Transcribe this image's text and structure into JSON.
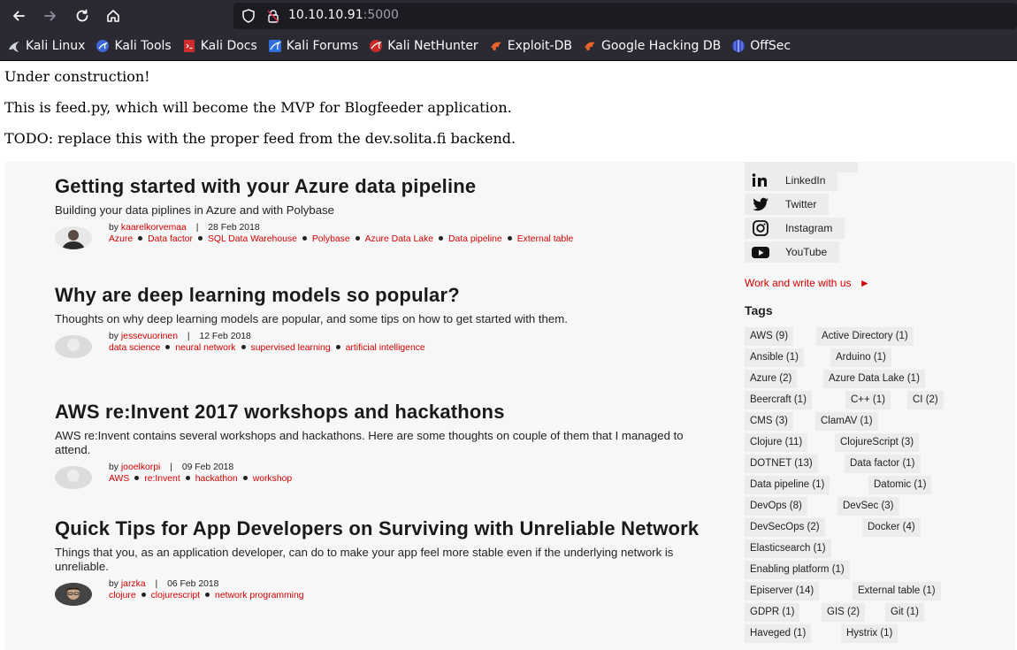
{
  "browser": {
    "url_host": "10.10.10.91",
    "url_port": ":5000",
    "bookmarks": [
      "Kali Linux",
      "Kali Tools",
      "Kali Docs",
      "Kali Forums",
      "Kali NetHunter",
      "Exploit-DB",
      "Google Hacking DB",
      "OffSec"
    ],
    "icons": {
      "back": "back-arrow-icon",
      "forward": "forward-arrow-icon",
      "reload": "reload-icon",
      "home": "home-icon",
      "shield": "shield-icon",
      "lock": "lock-icon"
    }
  },
  "page": {
    "lines": [
      "Under construction!",
      "This is feed.py, which will become the MVP for Blogfeeder application.",
      "TODO: replace this with the proper feed from the dev.solita.fi backend."
    ]
  },
  "blog": {
    "posts": [
      {
        "title": "Getting started with your Azure data pipeline",
        "desc": "Building your data piplines in Azure and with Polybase",
        "by": "by",
        "author": "kaarelkorvemaa",
        "sep": "|",
        "date": "28 Feb 2018",
        "tags": [
          "Azure",
          "Data factor",
          "SQL Data Warehouse",
          "Polybase",
          "Azure Data Lake",
          "Data pipeline",
          "External table"
        ]
      },
      {
        "title": "Why are deep learning models so popular?",
        "desc": "Thoughts on why deep learning models are popular, and some tips on how to get started with them.",
        "by": "by",
        "author": "jessevuorinen",
        "sep": "|",
        "date": "12 Feb 2018",
        "tags": [
          "data science",
          "neural network",
          "supervised learning",
          "artificial intelligence"
        ]
      },
      {
        "title": "AWS re:Invent 2017 workshops and hackathons",
        "desc": "AWS re:Invent contains several workshops and hackathons. Here are some thoughts on couple of them that I managed to attend.",
        "by": "by",
        "author": "jooelkorpi",
        "sep": "|",
        "date": "09 Feb 2018",
        "tags": [
          "AWS",
          "re:Invent",
          "hackathon",
          "workshop"
        ]
      },
      {
        "title": "Quick Tips for App Developers on Surviving with Unreliable Network",
        "desc": "Things that you, as an application developer, can do to make your app feel more stable even if the underlying network is unreliable.",
        "by": "by",
        "author": "jarzka",
        "sep": "|",
        "date": "06 Feb 2018",
        "tags": [
          "clojure",
          "clojurescript",
          "network programming"
        ]
      }
    ],
    "social": [
      {
        "label": "LinkedIn",
        "icon": "linkedin-icon"
      },
      {
        "label": "Twitter",
        "icon": "twitter-icon"
      },
      {
        "label": "Instagram",
        "icon": "instagram-icon"
      },
      {
        "label": "YouTube",
        "icon": "youtube-icon"
      }
    ],
    "write_link": "Work and write with us",
    "write_arrow": "►",
    "tags_heading": "Tags",
    "tags": [
      "AWS (9)",
      "Active Directory (1)",
      "Ansible (1)",
      "Arduino (1)",
      "Azure (2)",
      "Azure Data Lake (1)",
      "Beercraft (1)",
      "C++ (1)",
      "CI (2)",
      "CMS (3)",
      "ClamAV (1)",
      "Clojure (11)",
      "ClojureScript (3)",
      "DOTNET (13)",
      "Data factor (1)",
      "Data pipeline (1)",
      "Datomic (1)",
      "DevOps (8)",
      "DevSec (3)",
      "DevSecOps (2)",
      "Docker (4)",
      "Elasticsearch (1)",
      "Enabling platform (1)",
      "Episerver (14)",
      "External table (1)",
      "GDPR (1)",
      "GIS (2)",
      "Git (1)",
      "Haveged (1)",
      "Hystrix (1)"
    ],
    "colors": {
      "accent": "#d20000",
      "chrome": "#2b2a33",
      "urlbar": "#1c1b22"
    }
  }
}
